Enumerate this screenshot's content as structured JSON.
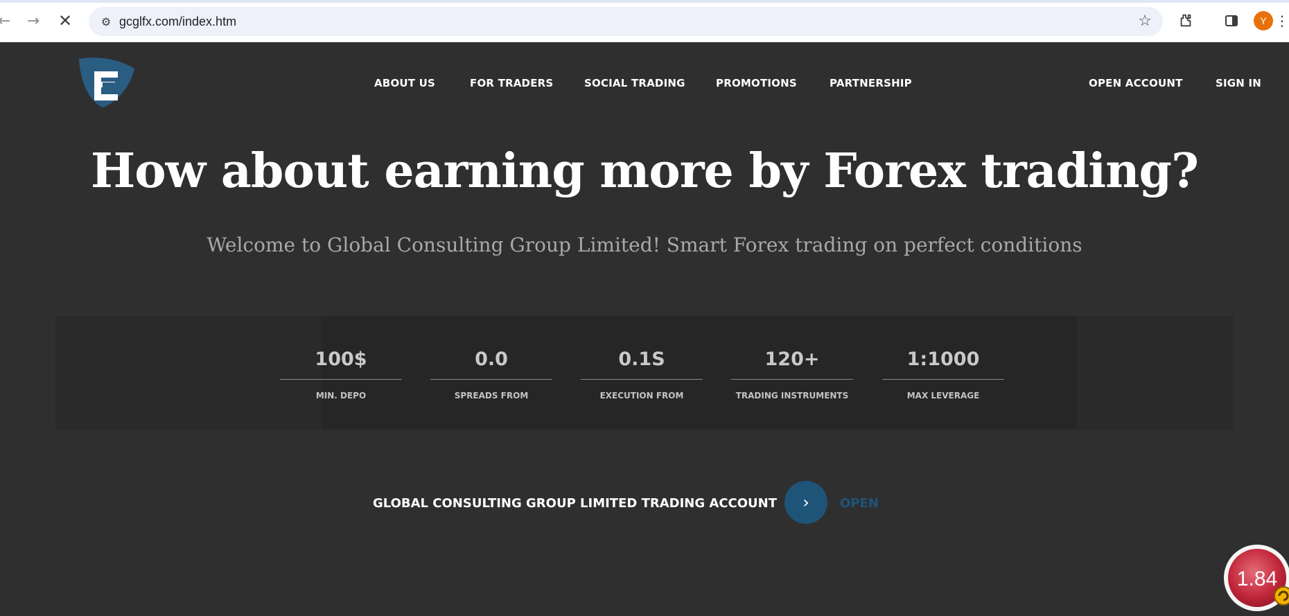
{
  "browser": {
    "url": "gcglfx.com/index.htm",
    "profile_initial": "Y"
  },
  "nav": {
    "items": [
      "ABOUT US",
      "FOR TRADERS",
      "SOCIAL TRADING",
      "PROMOTIONS",
      "PARTNERSHIP"
    ],
    "open_account": "OPEN ACCOUNT",
    "sign_in": "SIGN IN"
  },
  "hero": {
    "title": "How about earning more by Forex trading?",
    "subtitle": "Welcome to Global Consulting Group Limited! Smart Forex trading on perfect conditions"
  },
  "stats": [
    {
      "value": "100$",
      "label": "MIN. DEPO"
    },
    {
      "value": "0.0",
      "label": "SPREADS FROM"
    },
    {
      "value": "0.1S",
      "label": "EXECUTION FROM"
    },
    {
      "value": "120+",
      "label": "TRADING INSTRUMENTS"
    },
    {
      "value": "1:1000",
      "label": "MAX LEVERAGE"
    }
  ],
  "cta": {
    "label": "GLOBAL CONSULTING GROUP LIMITED TRADING ACCOUNT",
    "open": "OPEN"
  },
  "floating_widget": {
    "value": "1.84"
  },
  "colors": {
    "background": "#2f2f30",
    "accent": "#1f5479",
    "logo": "#2a5d82"
  },
  "icons": {
    "back": "arrow-left-icon",
    "forward": "arrow-right-icon",
    "stop": "close-icon",
    "site_info": "tune-icon",
    "bookmark": "star-icon",
    "extensions": "puzzle-icon",
    "side_panel": "side-panel-icon",
    "menu": "more-vert-icon",
    "cta_arrow": "chevron-right-icon"
  }
}
